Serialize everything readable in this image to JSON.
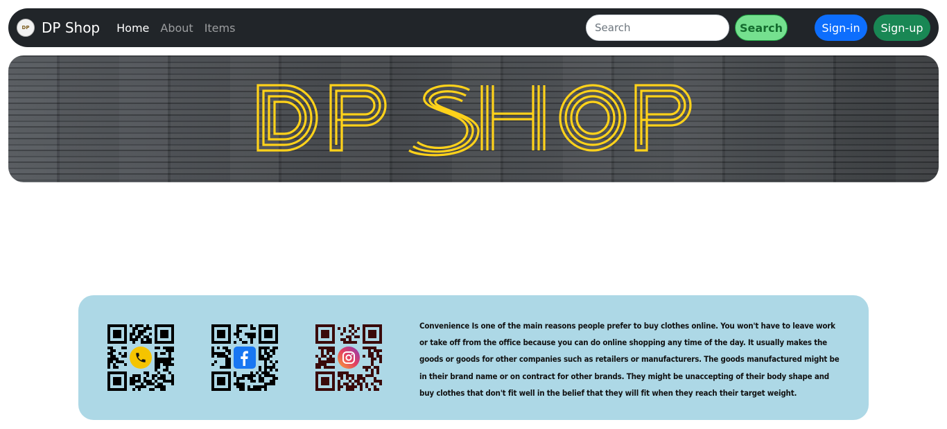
{
  "navbar": {
    "brand_name": "DP Shop",
    "logo_text": "DP",
    "links": [
      {
        "label": "Home",
        "active": true
      },
      {
        "label": "About",
        "active": false
      },
      {
        "label": "Items",
        "active": false
      }
    ],
    "search_placeholder": "Search",
    "search_button": "Search",
    "signin_button": "Sign-in",
    "signup_button": "Sign-up"
  },
  "banner": {
    "title": "DP SHOP",
    "title_color": "#ffd21a"
  },
  "footer": {
    "qr_codes": [
      {
        "name": "phone",
        "icon": "phone-icon",
        "icon_color": "#f5c400"
      },
      {
        "name": "facebook",
        "icon": "facebook-icon",
        "icon_color": "#1877f2"
      },
      {
        "name": "instagram",
        "icon": "instagram-icon",
        "icon_color": "#c13584"
      }
    ],
    "description": "Convenience Is one of the main reasons people prefer to buy clothes online. You won't have to leave work or take off from the office because you can do online shopping any time of the day. It usually makes the goods or goods for other companies such as retailers or manufacturers. The goods manufactured might be in their brand name or on contract for other brands. They might be unaccepting of their body shape and buy clothes that don't fit well in the belief that they will fit when they reach their target weight.",
    "background": "#add8e6"
  }
}
